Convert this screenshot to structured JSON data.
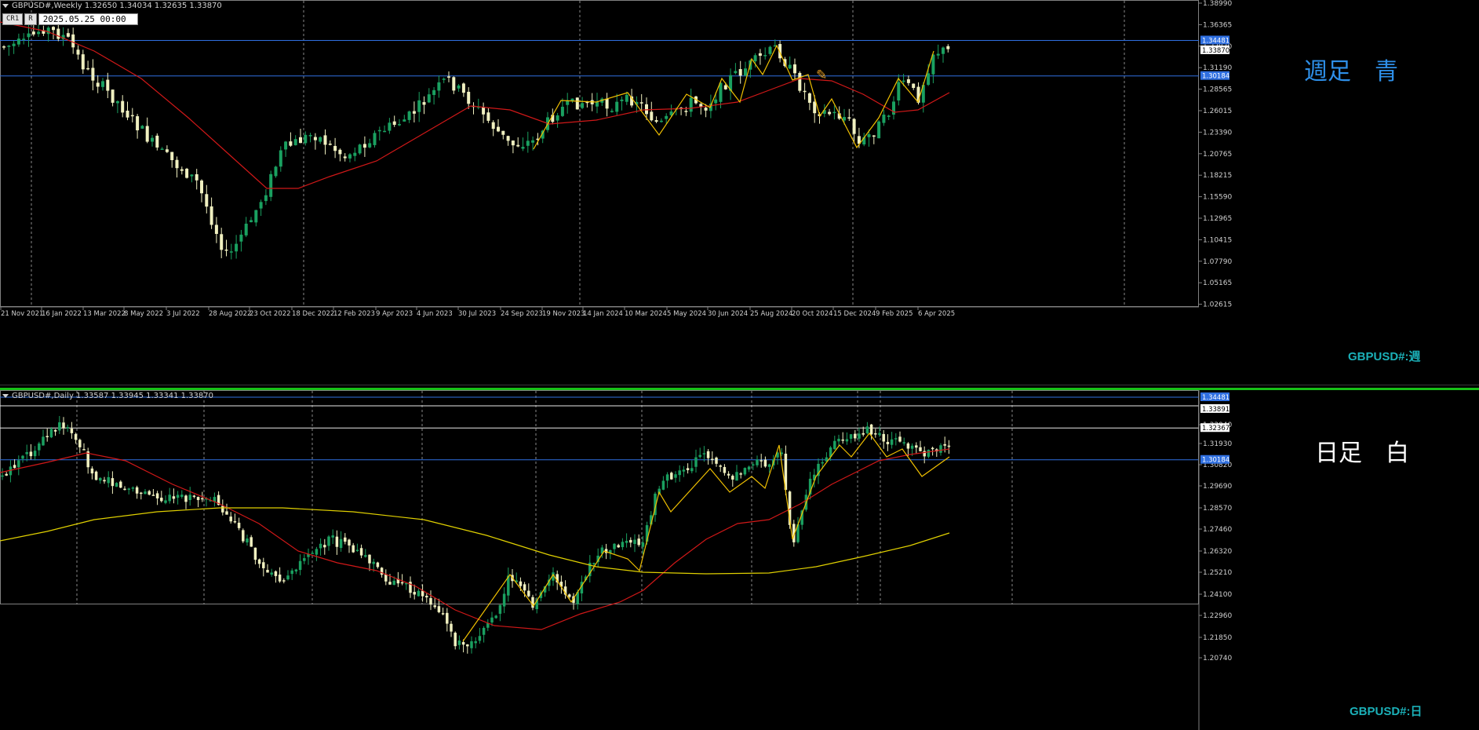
{
  "weekly": {
    "header": "GBPUSD#,Weekly  1.32650 1.34034 1.32635 1.33870",
    "toolbar": {
      "crosshair_label": "CR1",
      "reset_label": "R",
      "date_value": "2025.05.25 00:00"
    },
    "annotation": "週足　青",
    "symbol_label": "GBPUSD#:週",
    "price_axis": [
      "1.38990",
      "1.36365",
      "1.33870",
      "1.31190",
      "1.28565",
      "1.26015",
      "1.23390",
      "1.20765",
      "1.18215",
      "1.15590",
      "1.12965",
      "1.10415",
      "1.07790",
      "1.05165",
      "1.02615"
    ],
    "price_tags": [
      {
        "text": "1.34481",
        "kind": "blue"
      },
      {
        "text": "1.33870",
        "kind": "white"
      },
      {
        "text": "1.30184",
        "kind": "blue"
      }
    ],
    "date_axis": [
      "21 Nov 2021",
      "16 Jan 2022",
      "13 Mar 2022",
      "8 May 2022",
      "3 Jul 2022",
      "28 Aug 2022",
      "23 Oct 2022",
      "18 Dec 2022",
      "12 Feb 2023",
      "9 Apr 2023",
      "4 Jun 2023",
      "30 Jul 2023",
      "24 Sep 2023",
      "19 Nov 2023",
      "14 Jan 2024",
      "10 Mar 2024",
      "5 May 2024",
      "30 Jun 2024",
      "25 Aug 2024",
      "20 Oct 2024",
      "15 Dec 2024",
      "9 Feb 2025",
      "6 Apr 2025"
    ],
    "hlines": [
      1.34481,
      1.30184
    ],
    "colors": {
      "hline": "#2f6fe0",
      "ma": "#d01818",
      "zigzag": "#f0c000",
      "bull": "#1aa060",
      "bear": "#f0f0c0"
    }
  },
  "daily": {
    "header": "GBPUSD#,Daily  1.33587 1.33945 1.33341 1.33870",
    "annotation": "日足　白",
    "symbol_label": "GBPUSD#:日",
    "price_axis": [
      "1.34481",
      "1.33870",
      "1.33040",
      "1.31930",
      "1.30820",
      "1.29690",
      "1.28570",
      "1.27460",
      "1.26320",
      "1.25210",
      "1.24100",
      "1.22960",
      "1.21850",
      "1.20740"
    ],
    "price_tags": [
      {
        "text": "1.34481",
        "kind": "blue"
      },
      {
        "text": "1.33891",
        "kind": "white"
      },
      {
        "text": "1.32367",
        "kind": "white"
      },
      {
        "text": "1.30184",
        "kind": "blue"
      }
    ],
    "hlines_blue": [
      1.34481,
      1.30184
    ],
    "hlines_white": [
      1.33891,
      1.32367
    ],
    "colors": {
      "hline": "#2f6fe0",
      "hline_white": "#e8e8e8",
      "ma_fast": "#d01818",
      "ma_slow": "#e0d000",
      "zigzag": "#f0c000",
      "bull": "#1aa060",
      "bear": "#f0f0c0"
    }
  }
}
